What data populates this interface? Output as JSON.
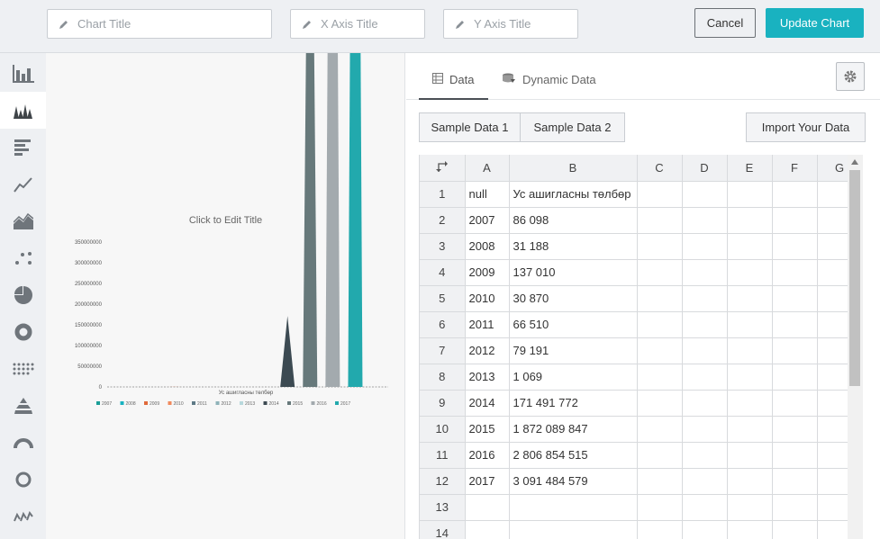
{
  "header": {
    "chart_title_placeholder": "Chart Title",
    "x_axis_placeholder": "X Axis Title",
    "y_axis_placeholder": "Y Axis Title",
    "cancel_label": "Cancel",
    "update_label": "Update Chart"
  },
  "sidebar": {
    "items": [
      "column-chart-icon",
      "spike-chart-icon",
      "bar-chart-icon",
      "line-chart-icon",
      "area-chart-icon",
      "scatter-chart-icon",
      "pie-chart-icon",
      "donut-chart-icon",
      "dot-matrix-icon",
      "pyramid-chart-icon",
      "gauge-chart-icon",
      "ring-chart-icon",
      "sparkline-icon"
    ],
    "active_index": 1
  },
  "preview": {
    "title": "Click to Edit Title"
  },
  "tabs": {
    "data_label": "Data",
    "dynamic_label": "Dynamic Data"
  },
  "buttons": {
    "sample1": "Sample Data 1",
    "sample2": "Sample Data 2",
    "import": "Import Your Data"
  },
  "grid": {
    "columns": [
      "A",
      "B",
      "C",
      "D",
      "E",
      "F",
      "G"
    ],
    "rows": [
      [
        "1",
        "null",
        "Ус ашигласны төлбөр"
      ],
      [
        "2",
        "2007",
        "86 098"
      ],
      [
        "3",
        "2008",
        "31 188"
      ],
      [
        "4",
        "2009",
        "137 010"
      ],
      [
        "5",
        "2010",
        "30 870"
      ],
      [
        "6",
        "2011",
        "66 510"
      ],
      [
        "7",
        "2012",
        "79 191"
      ],
      [
        "8",
        "2013",
        "1 069"
      ],
      [
        "9",
        "2014",
        "171 491 772"
      ],
      [
        "10",
        "2015",
        "1 872 089 847"
      ],
      [
        "11",
        "2016",
        "2 806 854 515"
      ],
      [
        "12",
        "2017",
        "3 091 484 579"
      ],
      [
        "13",
        "",
        ""
      ],
      [
        "14",
        "",
        ""
      ]
    ]
  },
  "chart_data": {
    "type": "bar",
    "title": "Click to Edit Title",
    "xlabel": "Ус ашигласны төлбөр",
    "ylim": [
      0,
      350000000
    ],
    "yticks": [
      "0",
      "50000000",
      "100000000",
      "150000000",
      "200000000",
      "250000000",
      "300000000",
      "350000000"
    ],
    "series": [
      {
        "name": "2007",
        "value": 86098,
        "color": "#1a9e97"
      },
      {
        "name": "2008",
        "value": 31188,
        "color": "#19b2c0"
      },
      {
        "name": "2009",
        "value": 137010,
        "color": "#e06a3b"
      },
      {
        "name": "2010",
        "value": 30870,
        "color": "#f08a5d"
      },
      {
        "name": "2011",
        "value": 66510,
        "color": "#5e7a86"
      },
      {
        "name": "2012",
        "value": 79191,
        "color": "#8fb3b9"
      },
      {
        "name": "2013",
        "value": 1069,
        "color": "#b8d8dc"
      },
      {
        "name": "2014",
        "value": 171491772,
        "color": "#3c4a52"
      },
      {
        "name": "2015",
        "value": 1872089847,
        "color": "#67797b"
      },
      {
        "name": "2016",
        "value": 2806854515,
        "color": "#a3aaae"
      },
      {
        "name": "2017",
        "value": 3091484579,
        "color": "#22a9ad"
      }
    ]
  }
}
